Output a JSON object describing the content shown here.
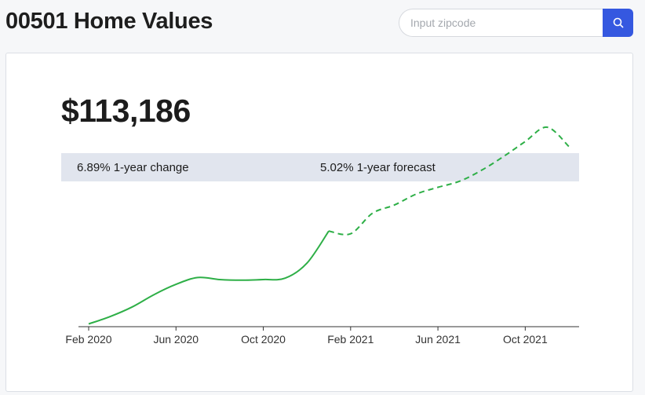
{
  "header": {
    "title": "00501 Home Values"
  },
  "search": {
    "placeholder": "Input zipcode",
    "value": "",
    "button_icon": "search-icon",
    "accent_color": "#3558e0"
  },
  "summary": {
    "price": "$113,186",
    "change": "6.89% 1-year change",
    "forecast": "5.02% 1-year forecast"
  },
  "chart_data": {
    "type": "line",
    "title": "",
    "xlabel": "",
    "ylabel": "",
    "grid": false,
    "legend": "none",
    "x_tick_labels": [
      "Feb 2020",
      "Jun 2020",
      "Oct 2020",
      "Feb 2021",
      "Jun 2021",
      "Oct 2021"
    ],
    "x_ticks": [
      "2020-02",
      "2020-06",
      "2020-10",
      "2021-02",
      "2021-06",
      "2021-10"
    ],
    "ylim": [
      100000,
      120000
    ],
    "series": [
      {
        "style": "solid",
        "color": "#2eaf47",
        "points": [
          [
            "2020-02",
            100200
          ],
          [
            "2020-03",
            100750
          ],
          [
            "2020-04",
            101450
          ],
          [
            "2020-05",
            102350
          ],
          [
            "2020-06",
            103100
          ],
          [
            "2020-07",
            103600
          ],
          [
            "2020-08",
            103450
          ],
          [
            "2020-09",
            103400
          ],
          [
            "2020-10",
            103450
          ],
          [
            "2020-11",
            103550
          ],
          [
            "2020-12",
            104650
          ],
          [
            "2021-01",
            107000
          ]
        ]
      },
      {
        "style": "dashed",
        "color": "#2eaf47",
        "points": [
          [
            "2021-01",
            107000
          ],
          [
            "2021-02",
            106800
          ],
          [
            "2021-03",
            108300
          ],
          [
            "2021-04",
            108900
          ],
          [
            "2021-05",
            109700
          ],
          [
            "2021-06",
            110200
          ],
          [
            "2021-07",
            110650
          ],
          [
            "2021-08",
            111450
          ],
          [
            "2021-09",
            112450
          ],
          [
            "2021-10",
            113550
          ],
          [
            "2021-11",
            114600
          ],
          [
            "2021-12",
            113186
          ]
        ]
      }
    ]
  }
}
